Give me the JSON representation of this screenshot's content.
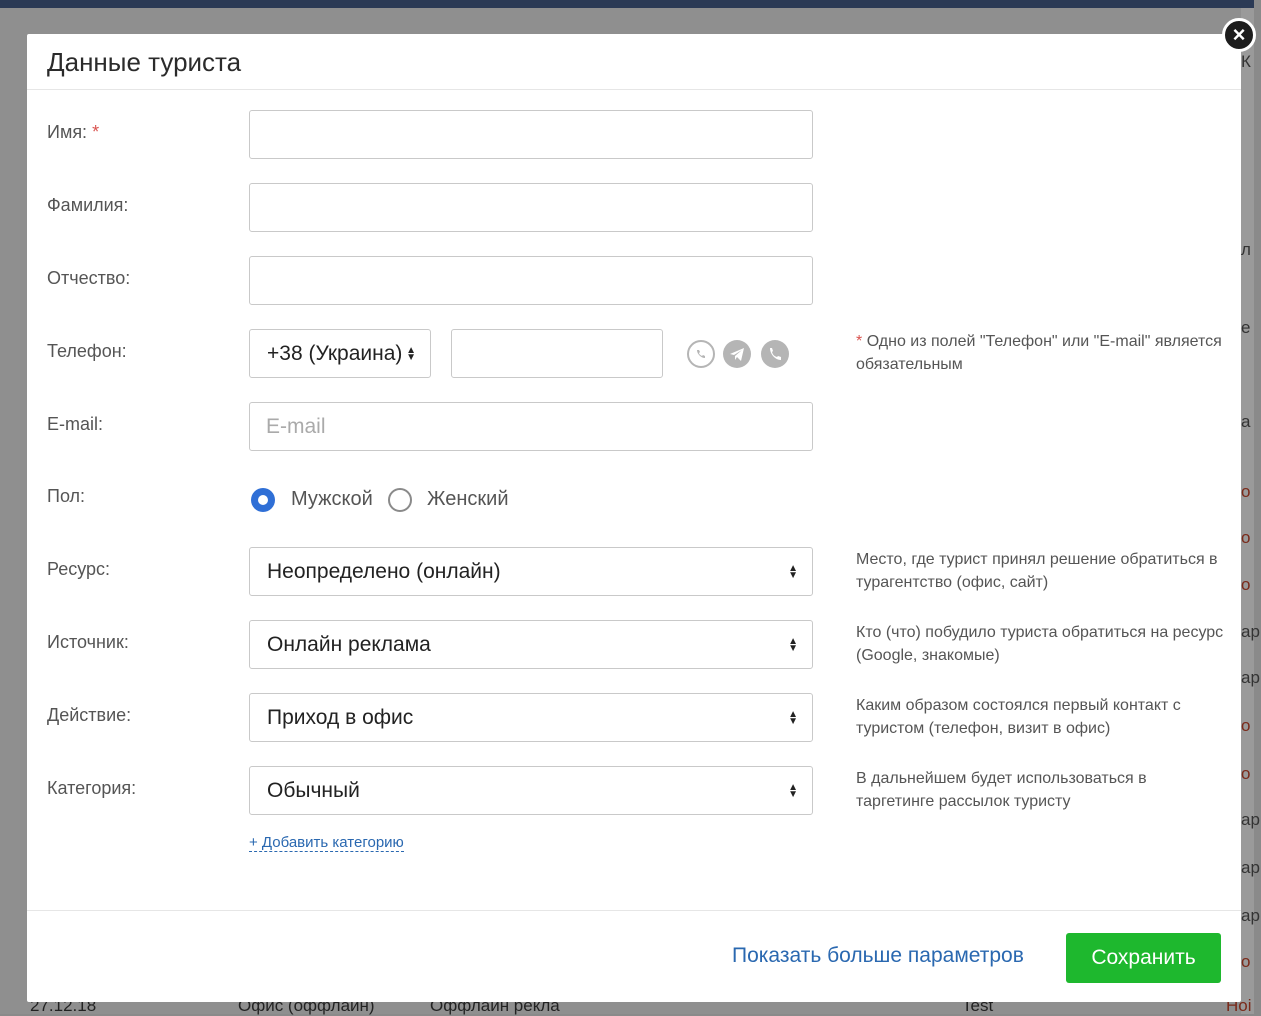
{
  "modal": {
    "title": "Данные туриста",
    "close_glyph": "×"
  },
  "form": {
    "first_name": {
      "label": "Имя:",
      "required_mark": "*",
      "value": ""
    },
    "last_name": {
      "label": "Фамилия:",
      "value": ""
    },
    "middle_name": {
      "label": "Отчество:",
      "value": ""
    },
    "phone": {
      "label": "Телефон:",
      "country_code": "+38 (Украина)",
      "number": "",
      "icons": [
        "whatsapp-icon",
        "telegram-icon",
        "viber-icon"
      ],
      "hint_star": "*",
      "hint": "Одно из полей \"Телефон\" или \"E-mail\" является обязательным"
    },
    "email": {
      "label": "E-mail:",
      "placeholder": "E-mail",
      "value": ""
    },
    "gender": {
      "label": "Пол:",
      "options": [
        {
          "label": "Мужской",
          "selected": true
        },
        {
          "label": "Женский",
          "selected": false
        }
      ]
    },
    "resource": {
      "label": "Ресурс:",
      "value": "Неопределено (онлайн)",
      "hint": "Место, где турист принял решение обратиться в турагентство (офис, сайт)"
    },
    "source": {
      "label": "Источник:",
      "value": "Онлайн реклама",
      "hint": "Кто (что) побудило туриста обратиться на ресурс (Google, знакомые)"
    },
    "action": {
      "label": "Действие:",
      "value": "Приход в офис",
      "hint": "Каким образом состоялся первый контакт с туристом (телефон, визит в офис)"
    },
    "category": {
      "label": "Категория:",
      "value": "Обычный",
      "hint": "В дальнейшем будет использоваться в таргетинге рассылок туристу",
      "add_link": "+ Добавить категорию"
    }
  },
  "footer": {
    "more_params": "Показать больше параметров",
    "save": "Сохранить"
  },
  "background": {
    "fragments": [
      "К",
      "л",
      "е",
      "а",
      "о",
      "о",
      "о",
      "ар",
      "ар",
      "о",
      "о",
      "ар",
      "ар",
      "ар",
      "о"
    ],
    "bottom_row": [
      "27.12.18",
      "Офис (оффлайн)",
      "Оффлайн рекла",
      "Test",
      "Ноі"
    ]
  },
  "colors": {
    "accent": "#2f6fd6",
    "link": "#2a68b0",
    "save_button": "#1eb82e",
    "required": "#d9534f"
  }
}
